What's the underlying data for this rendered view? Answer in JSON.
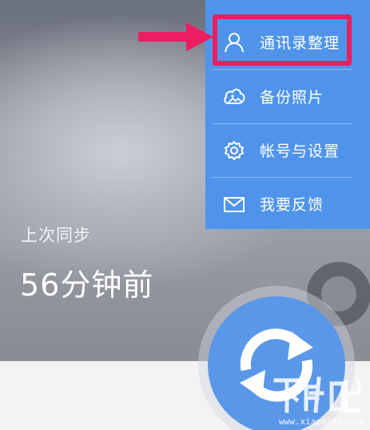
{
  "sync": {
    "label": "上次同步",
    "time": "56分钟前"
  },
  "menu": {
    "items": [
      {
        "label": "通讯录整理",
        "icon": "person-icon"
      },
      {
        "label": "备份照片",
        "icon": "cloud-photo-icon"
      },
      {
        "label": "帐号与设置",
        "icon": "gear-icon"
      },
      {
        "label": "我要反馈",
        "icon": "mail-icon"
      }
    ],
    "highlighted_index": 0
  },
  "watermark": {
    "logo": "下载吧",
    "url": "www.xiazaiba.com"
  },
  "colors": {
    "menu_bg": "#4f94ea",
    "sync_button": "#5a97e8",
    "highlight": "#ec1e62"
  }
}
